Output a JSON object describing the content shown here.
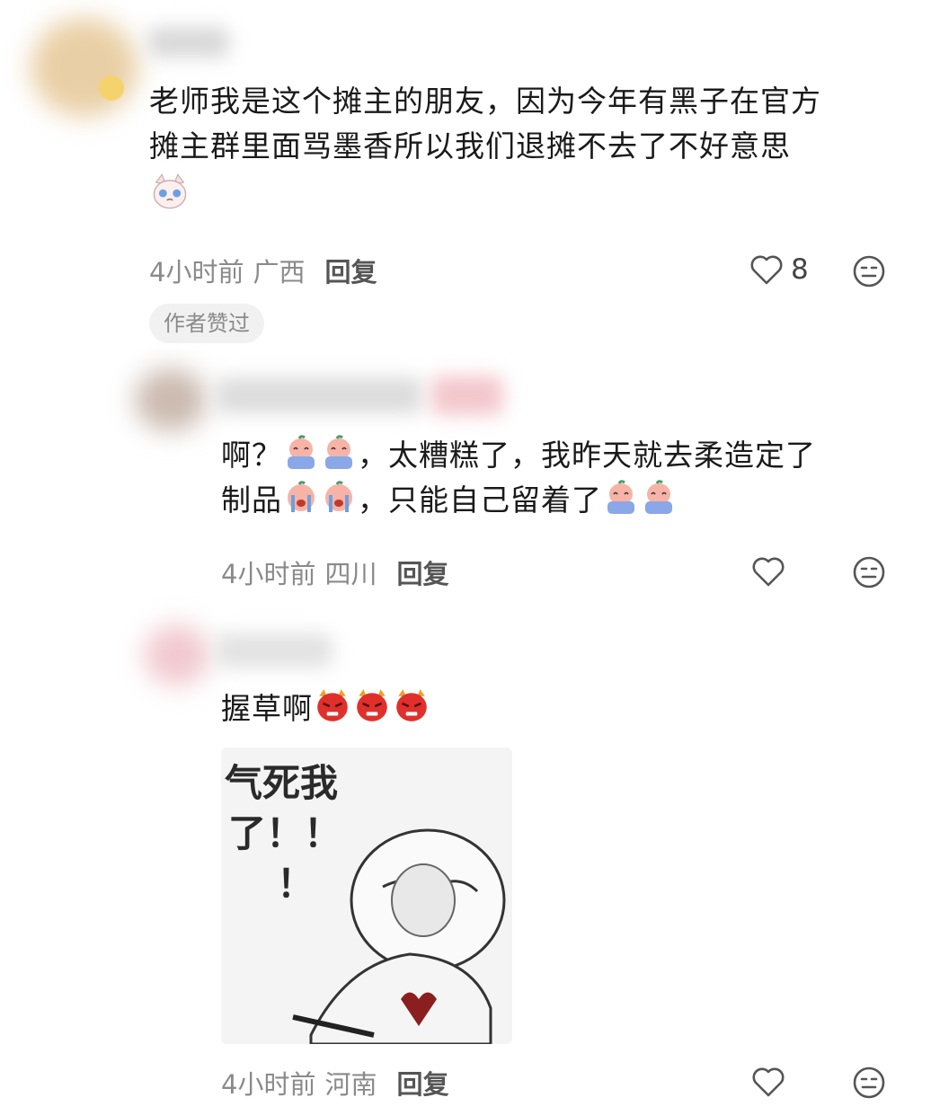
{
  "comments": [
    {
      "text_line1": "老师我是这个摊主的朋友，因为今年有黑子在官方",
      "text_line2": "摊主群里面骂墨香所以我们退摊不去了不好意思",
      "time": "4小时前",
      "location": "广西",
      "reply_label": "回复",
      "like_count": "8",
      "badge": "作者赞过"
    },
    {
      "text_line1_a": "啊？",
      "text_line1_b": "，太糟糕了，我昨天就去柔造定了",
      "text_line2_a": "制品",
      "text_line2_b": "，只能自己留着了",
      "time": "4小时前",
      "location": "四川",
      "reply_label": "回复"
    },
    {
      "text": "握草啊",
      "meme_line1": "气死我",
      "meme_line2": "了！！",
      "meme_line3": "！",
      "time": "4小时前",
      "location": "河南",
      "reply_label": "回复"
    }
  ],
  "icons": {
    "like": "heart-outline-icon",
    "react": "meh-face-icon"
  },
  "colors": {
    "emoji_red": "#e0302b",
    "emoji_blue": "#8aa7e8",
    "emoji_peach": "#f6b3a6"
  }
}
